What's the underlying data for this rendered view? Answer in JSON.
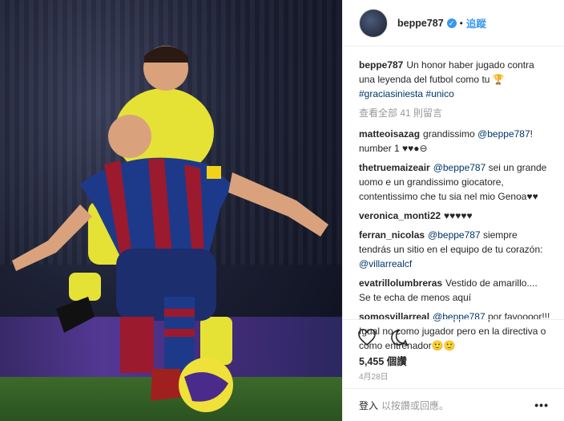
{
  "header": {
    "username": "beppe787",
    "dot": "•",
    "follow_label": "追蹤"
  },
  "caption": {
    "user": "beppe787",
    "text": "Un honor haber jugado contra una leyenda del futbol como tu 🏆",
    "hashtags": [
      "#graciasiniesta",
      "#unico"
    ]
  },
  "view_all": "查看全部 41 則留言",
  "comments": [
    {
      "user": "matteoisazag",
      "mention": "@beppe787",
      "text": "! number 1 ♥♥●⊖",
      "pre": "grandissimo "
    },
    {
      "user": "thetruemaizeair",
      "mention": "@beppe787",
      "pre": "",
      "text": " sei un grande uomo e un grandissimo giocatore, contentissimo che tu sia nel mio Genoa♥♥"
    },
    {
      "user": "veronica_monti22",
      "mention": "",
      "pre": "♥♥♥♥♥",
      "text": ""
    },
    {
      "user": "ferran_nicolas",
      "mention": "@beppe787",
      "pre": "",
      "text": " siempre tendrás un sitio en el equipo de tu corazón: ",
      "mention2": "@villarrealcf"
    },
    {
      "user": "evatrillolumbreras",
      "mention": "",
      "pre": "Vestido de amarillo.... Se te echa de menos aquí",
      "text": ""
    },
    {
      "user": "somosvillarreal",
      "mention": "@beppe787",
      "pre": "",
      "text": " por favoooor!!! Igual no como jugador pero en la directiva o como entrenador🙂🙂"
    }
  ],
  "likes": "5,455 個讚",
  "date": "4月28日",
  "login": {
    "link": "登入",
    "text": "以按讚或回應。",
    "more": "•••"
  },
  "colors": {
    "link": "#003569",
    "follow": "#3897f0",
    "muted": "#999999"
  },
  "icons": {
    "like": "heart-icon",
    "comment": "comment-icon",
    "verified": "verified-badge-icon",
    "more": "more-options-icon"
  }
}
